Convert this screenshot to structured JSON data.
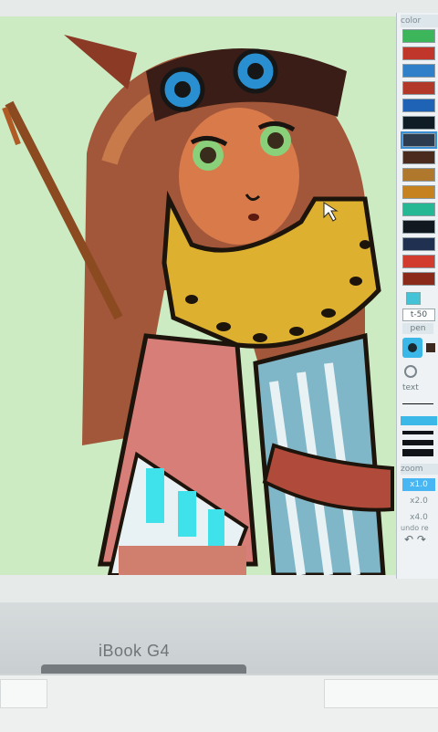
{
  "photo": {
    "description_free": true,
    "laptop_brand": "iBook G4"
  },
  "palette_panel": {
    "title": "color",
    "swatches": [
      "#3db55b",
      "#c0362a",
      "#2f7fc9",
      "#b2382a",
      "#1f63b7",
      "#0f1c26",
      "#2d3b4f",
      "#4a2b1d",
      "#b0782d",
      "#c6821f",
      "#26b794",
      "#111820",
      "#203050",
      "#d13c2f",
      "#8b2a1a"
    ],
    "selected_index": 6,
    "small_swatch_label": "",
    "size_value": "t-50",
    "pen_label": "pen",
    "text_label": "text",
    "zoom_label": "zoom",
    "zoom_options": [
      "x1.0",
      "x2.0",
      "x4.0"
    ],
    "zoom_active_index": 0,
    "undo_label": "undo",
    "redo_label": "re"
  },
  "accent_colors": {
    "canvas_bg": "#ccebc2",
    "highlight": "#48b6f2"
  }
}
